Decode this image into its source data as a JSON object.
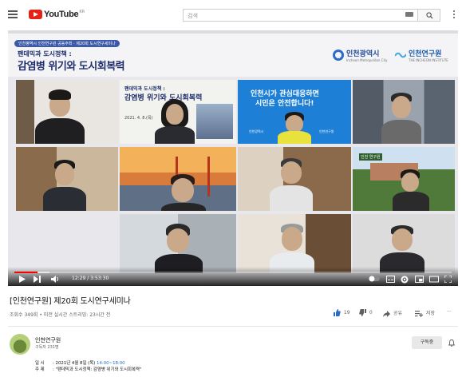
{
  "header": {
    "logo_text": "YouTube",
    "logo_suffix": "KR",
    "search_placeholder": "검색"
  },
  "video": {
    "tagline": "인천평역시 인천연구원 공동주최 · 제20회 도시연구세미나",
    "title_line1": "팬데믹과 도시정책 :",
    "title_line2": "감염병 위기와 도시회복력",
    "org1_name": "인천광역시",
    "org1_sub": "Incheon Metropolitan City",
    "org2_name": "인천연구원",
    "org2_sub": "THE INCHEON INSTITUTE",
    "slide_title1": "팬데믹과 도시정책 :",
    "slide_title2": "감염병 위기와 도시회복력",
    "slide_date": "2021. 4. 8.(목)",
    "banner_line1": "인천시가 관심대응하면",
    "banner_line2": "시민은 안전합니다!",
    "banner_org1": "인천광역시",
    "banner_org2": "인천연구원",
    "sign_text": "인천 연구원",
    "time": "12:29 / 3:53:30",
    "progress_fraction": 0.053,
    "loaded_fraction": 0.08
  },
  "info": {
    "title": "[인천연구원] 제20회 도시연구세미나",
    "meta": "조회수 349회 • 미전 실시간 스트리밍: 23시간 전",
    "likes": "19",
    "dislikes": "0",
    "share": "공유",
    "save": "저장",
    "more": "···"
  },
  "channel": {
    "name": "인천연구원",
    "subscribers": "구독자 231명",
    "subscribe": "구독중"
  },
  "description": {
    "date_key": "일      시",
    "date_value": ": 2021년 4월 8일 (목)",
    "date_time": "14:00~18:00",
    "topic_key": "주      제",
    "topic_value": ": \"팬데믹과 도시정책: 감염병 위기와 도시회복력\""
  },
  "colors": {
    "accent_red": "#e62117",
    "brand_blue": "#1d2d6b",
    "like_blue": "#2a6cc8"
  }
}
